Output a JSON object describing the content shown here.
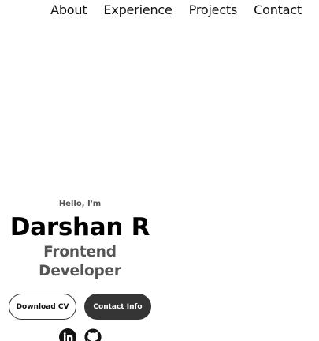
{
  "nav": {
    "items": [
      {
        "label": "About"
      },
      {
        "label": "Experience"
      },
      {
        "label": "Projects"
      },
      {
        "label": "Contact"
      }
    ]
  },
  "hero": {
    "greeting": "Hello, I'm",
    "name": "Darshan R",
    "role": "Frontend Developer",
    "download_label": "Download CV",
    "contact_label": "Contact Info"
  },
  "socials": {
    "icons": [
      "linkedin-icon",
      "github-icon"
    ]
  }
}
